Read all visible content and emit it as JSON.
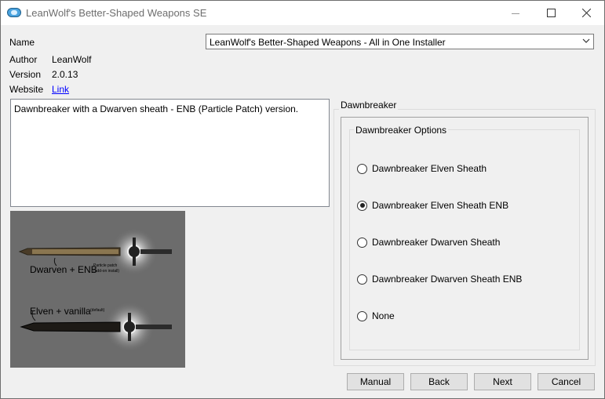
{
  "window": {
    "title": "LeanWolf's Better-Shaped Weapons SE",
    "icon": "mod-organizer-icon"
  },
  "info": {
    "name_label": "Name",
    "name_value": "LeanWolf's Better-Shaped Weapons - All in One Installer",
    "author_label": "Author",
    "author_value": "LeanWolf",
    "version_label": "Version",
    "version_value": "2.0.13",
    "website_label": "Website",
    "website_link": "Link"
  },
  "description": "Dawnbreaker with a Dwarven sheath - ENB (Particle Patch) version.",
  "preview": {
    "caption_top": "Dwarven + ENB",
    "caption_top_small": "Particle patch",
    "caption_top_small2": "(add-on install)",
    "caption_bottom": "Elven + vanilla",
    "caption_bottom_small": "(default)"
  },
  "group": {
    "title": "Dawnbreaker",
    "inner_title": "Dawnbreaker Options",
    "options": [
      {
        "label": "Dawnbreaker Elven Sheath",
        "checked": false
      },
      {
        "label": "Dawnbreaker Elven Sheath ENB",
        "checked": true
      },
      {
        "label": "Dawnbreaker Dwarven Sheath",
        "checked": false
      },
      {
        "label": "Dawnbreaker Dwarven Sheath ENB",
        "checked": false
      },
      {
        "label": "None",
        "checked": false
      }
    ]
  },
  "buttons": {
    "manual": "Manual",
    "back": "Back",
    "next": "Next",
    "cancel": "Cancel"
  }
}
